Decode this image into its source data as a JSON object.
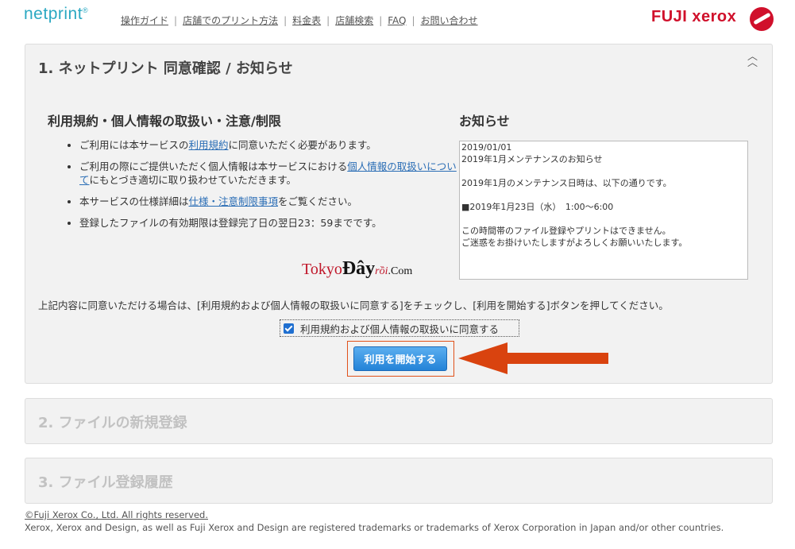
{
  "header": {
    "logo_text": "netprint",
    "logo_mark": "®",
    "nav": [
      "操作ガイド",
      "店舗でのプリント方法",
      "料金表",
      "店舗検索",
      "FAQ",
      "お問い合わせ"
    ],
    "brand_logo": "FUJI xerox"
  },
  "panel1": {
    "title": "1. ネットプリント 同意確認 / お知らせ",
    "collapse_icon": "double-chevron-up-icon",
    "terms_heading": "利用規約・個人情報の取扱い・注意/制限",
    "terms": [
      {
        "pre": "ご利用には本サービスの",
        "link": "利用規約",
        "post": "に同意いただく必要があります。"
      },
      {
        "pre": "ご利用の際にご提供いただく個人情報は本サービスにおける",
        "link": "個人情報の取扱いについて",
        "post": "にもとづき適切に取り扱わせていただきます。"
      },
      {
        "pre": "本サービスの仕様詳細は",
        "link": "仕様・注意制限事項",
        "post": "をご覧ください。"
      },
      {
        "pre": "登録したファイルの有効期限は登録完了日の翌日23：59までです。",
        "link": "",
        "post": ""
      }
    ],
    "news_heading": "お知らせ",
    "news_text": "2019/01/01\n2019年1月メンテナンスのお知らせ\n\n2019年1月のメンテナンス日時は、以下の通りです。\n\n■2019年1月23日（水）　1:00〜6:00\n\nこの時間帯のファイル登録やプリントはできません。\nご迷惑をお掛けいたしますがよろしくお願いいたします。",
    "watermark": {
      "a": "Tokyo",
      "b": "Đây",
      "c": "rồi",
      "d": ".Com"
    },
    "instruction": "上記内容に同意いただける場合は、[利用規約および個人情報の取扱いに同意する]をチェックし、[利用を開始する]ボタンを押してください。",
    "agree_label": "利用規約および個人情報の取扱いに同意する",
    "agree_checked": true,
    "start_button": "利用を開始する",
    "arrow_color": "#d9430f"
  },
  "panel2": {
    "title": "2. ファイルの新規登録"
  },
  "panel3": {
    "title": "3. ファイル登録履歴"
  },
  "footer": {
    "copyright": "©Fuji Xerox Co., Ltd. All rights reserved.",
    "trademark": "Xerox, Xerox and Design, as well as Fuji Xerox and Design are registered trademarks or trademarks of Xerox Corporation in Japan and/or other countries."
  }
}
